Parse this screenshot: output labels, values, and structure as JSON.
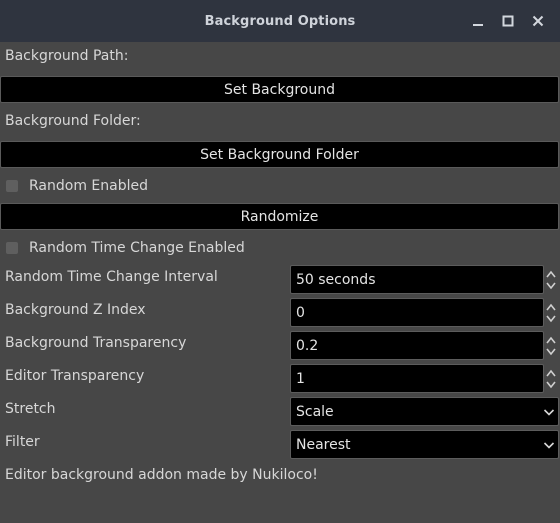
{
  "window": {
    "title": "Background Options"
  },
  "background_path": {
    "label": "Background Path:",
    "button_label": "Set Background"
  },
  "background_folder": {
    "label": "Background Folder:",
    "button_label": "Set Background Folder"
  },
  "random": {
    "enabled_label": "Random Enabled",
    "enabled_checked": false,
    "randomize_label": "Randomize",
    "time_change_label": "Random Time Change Enabled",
    "time_change_checked": false
  },
  "fields": {
    "interval": {
      "label": "Random Time Change Interval",
      "value": "50 seconds"
    },
    "z_index": {
      "label": "Background Z Index",
      "value": "0"
    },
    "bg_transparency": {
      "label": "Background Transparency",
      "value": "0.2"
    },
    "editor_transparency": {
      "label": "Editor Transparency",
      "value": "1"
    },
    "stretch": {
      "label": "Stretch",
      "value": "Scale"
    },
    "filter": {
      "label": "Filter",
      "value": "Nearest"
    }
  },
  "footer": {
    "credit": "Editor background addon made by Nukiloco!"
  },
  "icons": {
    "minimize": "minimize-icon",
    "maximize": "maximize-icon",
    "close": "close-icon",
    "spinner": "spinner-arrows-icon",
    "dropdown": "chevron-down-icon"
  },
  "colors": {
    "titlebar": "#2f343f",
    "panel": "#474747",
    "field": "#000000",
    "text": "#d7d7d7"
  }
}
